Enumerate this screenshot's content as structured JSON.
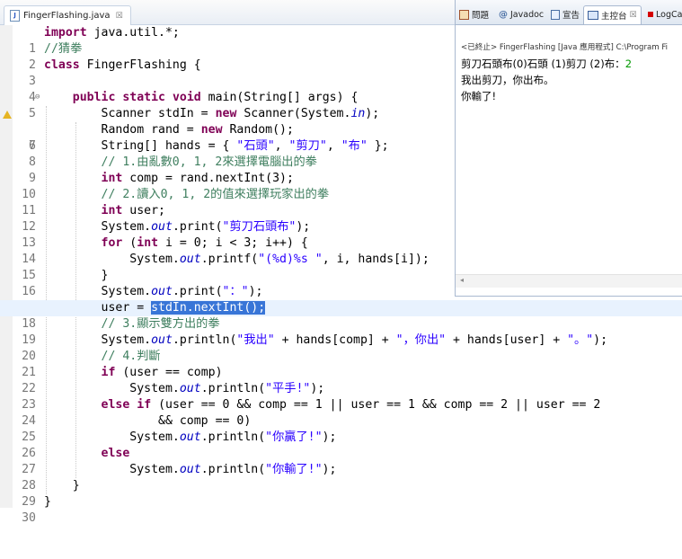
{
  "editor": {
    "tab_label": "FingerFlashing.java",
    "tab_icon": "java-file-icon",
    "tab_close": "☒"
  },
  "code": {
    "lines": [
      {
        "n": "1"
      },
      {
        "n": "2"
      },
      {
        "n": "3"
      },
      {
        "n": "4"
      },
      {
        "n": "5"
      },
      {
        "n": "6"
      },
      {
        "n": "7"
      },
      {
        "n": "8"
      },
      {
        "n": "9"
      },
      {
        "n": "10"
      },
      {
        "n": "11"
      },
      {
        "n": "12"
      },
      {
        "n": "13"
      },
      {
        "n": "14"
      },
      {
        "n": "15"
      },
      {
        "n": "16"
      },
      {
        "n": "17"
      },
      {
        "n": "18"
      },
      {
        "n": "19"
      },
      {
        "n": "20"
      },
      {
        "n": "21"
      },
      {
        "n": "22"
      },
      {
        "n": "23"
      },
      {
        "n": "24"
      },
      {
        "n": "25"
      },
      {
        "n": "26"
      },
      {
        "n": "27"
      },
      {
        "n": "28"
      },
      {
        "n": "29"
      },
      {
        "n": "30"
      }
    ],
    "t": {
      "import": "import",
      "import_rest": " java.util.*;",
      "c2": "//猜拳",
      "class": "class",
      "class_rest": " FingerFlashing {",
      "public": "public",
      "static": "static",
      "void": "void",
      "main_rest": " main(String[] args) {",
      "scanner_a": "Scanner stdIn = ",
      "new": "new",
      "scanner_b": " Scanner(System.",
      "in": "in",
      "scanner_c": ");",
      "random_a": "Random rand = ",
      "random_b": " Random();",
      "hands_a": "String[] hands = { ",
      "s_rock": "\"石頭\"",
      "comma": ", ",
      "s_scissors": "\"剪刀\"",
      "s_paper": "\"布\"",
      "hands_b": " };",
      "c9": "// 1.由亂數0, 1, 2來選擇電腦出的拳",
      "int": "int",
      "comp_rest": " comp = rand.nextInt(3);",
      "c11": "// 2.讀入0, 1, 2的值來選擇玩家出的拳",
      "user_rest": " user;",
      "sys": "System.",
      "out": "out",
      "print_open": ".print(",
      "s_prompt": "\"剪刀石頭布\"",
      "close_paren": ");",
      "for": "for",
      "for_paren": " (",
      "for_rest": " i = 0; i < 3; i++) {",
      "printf_open": ".printf(",
      "s_fmt": "\"(%d)%s \"",
      "printf_rest": ", i, hands[i]);",
      "brace_close": "}",
      "s_colon": "\"：\"",
      "user_assign": "user = ",
      "sel_text": "stdIn.nextInt();",
      "c19": "// 3.顯示雙方出的拳",
      "println_open": ".println(",
      "s_me": "\"我出\"",
      "concat1": " + hands[comp] + ",
      "s_you": "\"，你出\"",
      "concat2": " + hands[user] + ",
      "s_period": "\"。\"",
      "c21": "// 4.判斷",
      "if": "if",
      "if_cond": " (user == comp)",
      "s_tie": "\"平手!\"",
      "else": "else",
      "elseif_cond": " (user == 0 && comp == 1 || user == 1 && comp == 2 || user == 2",
      "cont_line": "&& comp == 0)",
      "s_win": "\"你贏了!\"",
      "s_lose": "\"你輸了!\"",
      "end_brace": "}"
    }
  },
  "console": {
    "tabs": [
      {
        "label": "問題",
        "icon": "problems-icon"
      },
      {
        "label": "Javadoc",
        "icon": "javadoc-icon"
      },
      {
        "label": "宣告",
        "icon": "declaration-icon"
      },
      {
        "label": "主控台",
        "icon": "console-icon",
        "active": true
      },
      {
        "label": "LogCa",
        "icon": "logcat-icon"
      }
    ],
    "close": "☒",
    "header": "<已終止> FingerFlashing [Java 應用程式] C:\\Program Fi",
    "line1_prefix": "剪刀石頭布(0)石頭 (1)剪刀 (2)布：",
    "line1_input": "2",
    "line2": "我出剪刀，你出布。",
    "line3": "你輸了!",
    "scroll_left": "◂"
  },
  "colors": {
    "keyword": "#7f0055",
    "comment": "#3f7f5f",
    "string": "#2a00ff",
    "field": "#0000c0",
    "selection": "#3875d7",
    "current_line": "#e8f2fe",
    "console_input": "#009900"
  }
}
